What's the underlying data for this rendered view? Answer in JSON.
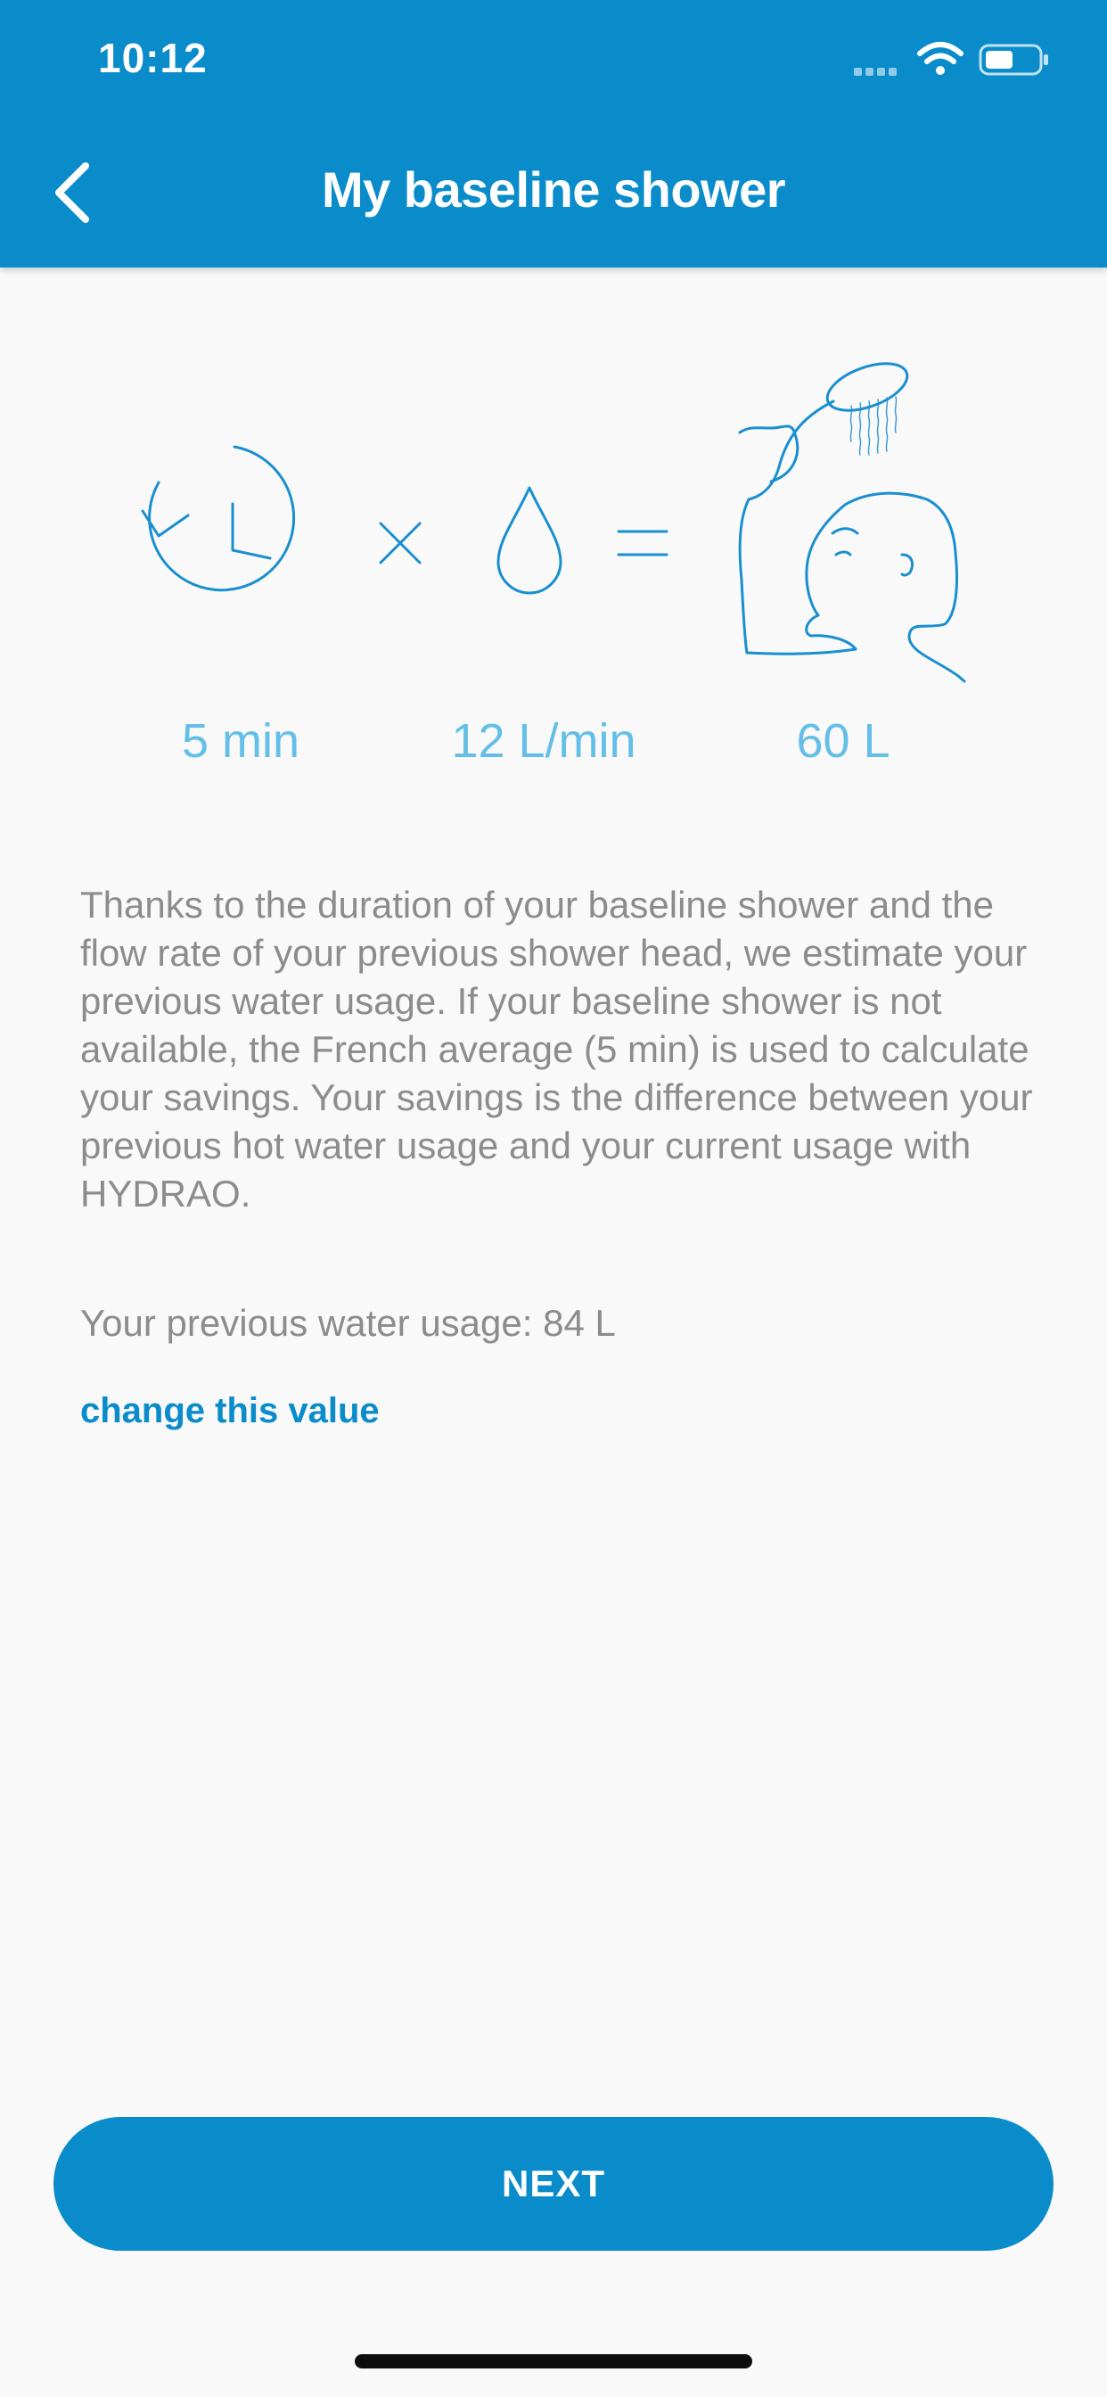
{
  "status_bar": {
    "time": "10:12"
  },
  "header": {
    "title": "My baseline shower",
    "back_icon": "chevron-left-icon"
  },
  "illustration": {
    "icons": [
      "clock-icon",
      "multiply-icon",
      "water-drop-icon",
      "equals-icon",
      "person-showering-icon"
    ],
    "accent_color": "#1a8fd0"
  },
  "metrics": {
    "duration": "5 min",
    "flow_rate": "12 L/min",
    "total": "60 L",
    "color": "#63bfe8"
  },
  "description": "Thanks to the duration of your baseline shower and the flow rate of your previous shower head, we estimate your previous water usage. If your baseline shower is not available, the French average (5 min) is used to calculate your savings. Your savings is the difference between your previous hot water usage and your current usage with HYDRAO.",
  "usage": {
    "text": "Your previous water usage: 84 L",
    "change_link": "change this value"
  },
  "actions": {
    "next_label": "NEXT"
  },
  "colors": {
    "brand": "#0a8ccb",
    "background": "#f9f9f9",
    "text_muted": "#8c8c8c"
  }
}
